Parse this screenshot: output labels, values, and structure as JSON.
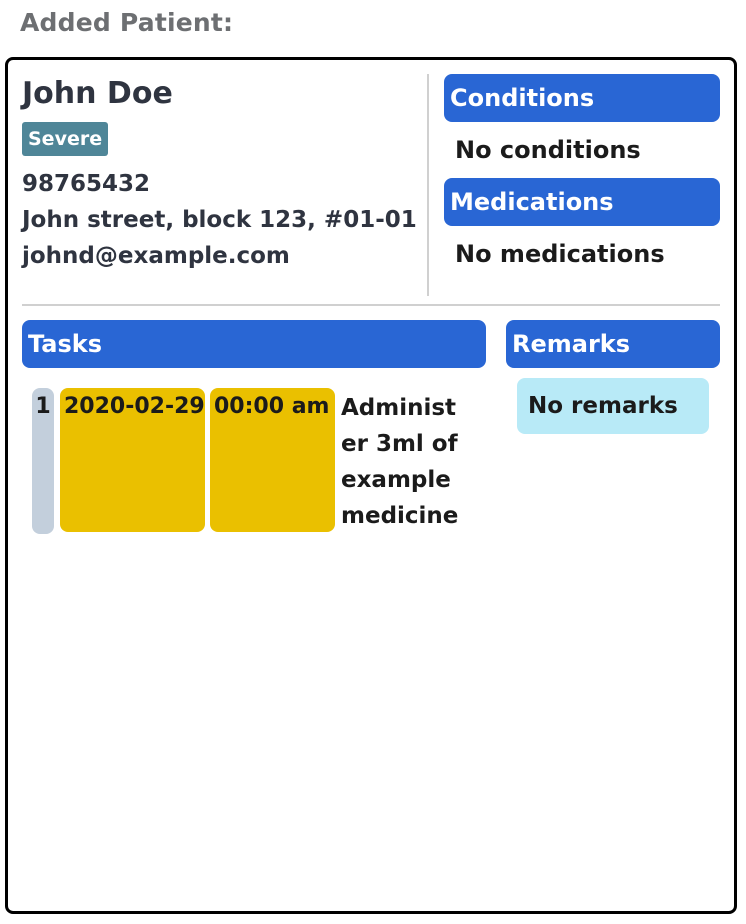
{
  "page": {
    "heading": "Added Patient:"
  },
  "patient": {
    "name": "John Doe",
    "severity": "Severe",
    "phone": "98765432",
    "address": "John street, block 123, #01-01",
    "email": "johnd@example.com"
  },
  "conditions": {
    "header": "Conditions",
    "empty_text": "No conditions"
  },
  "medications": {
    "header": "Medications",
    "empty_text": "No medications"
  },
  "tasks": {
    "header": "Tasks",
    "items": [
      {
        "index": "1",
        "date": "2020-02-29",
        "time": "00:00 am",
        "description": "Administer 3ml of example medicine"
      }
    ]
  },
  "remarks": {
    "header": "Remarks",
    "empty_text": "No remarks"
  },
  "colors": {
    "section_header_bg": "#2966d4",
    "severity_badge_bg": "#4f8698",
    "task_datetime_bg": "#eac000",
    "task_index_bg": "#c3cfdc",
    "remark_bg": "#b8eaf7"
  }
}
